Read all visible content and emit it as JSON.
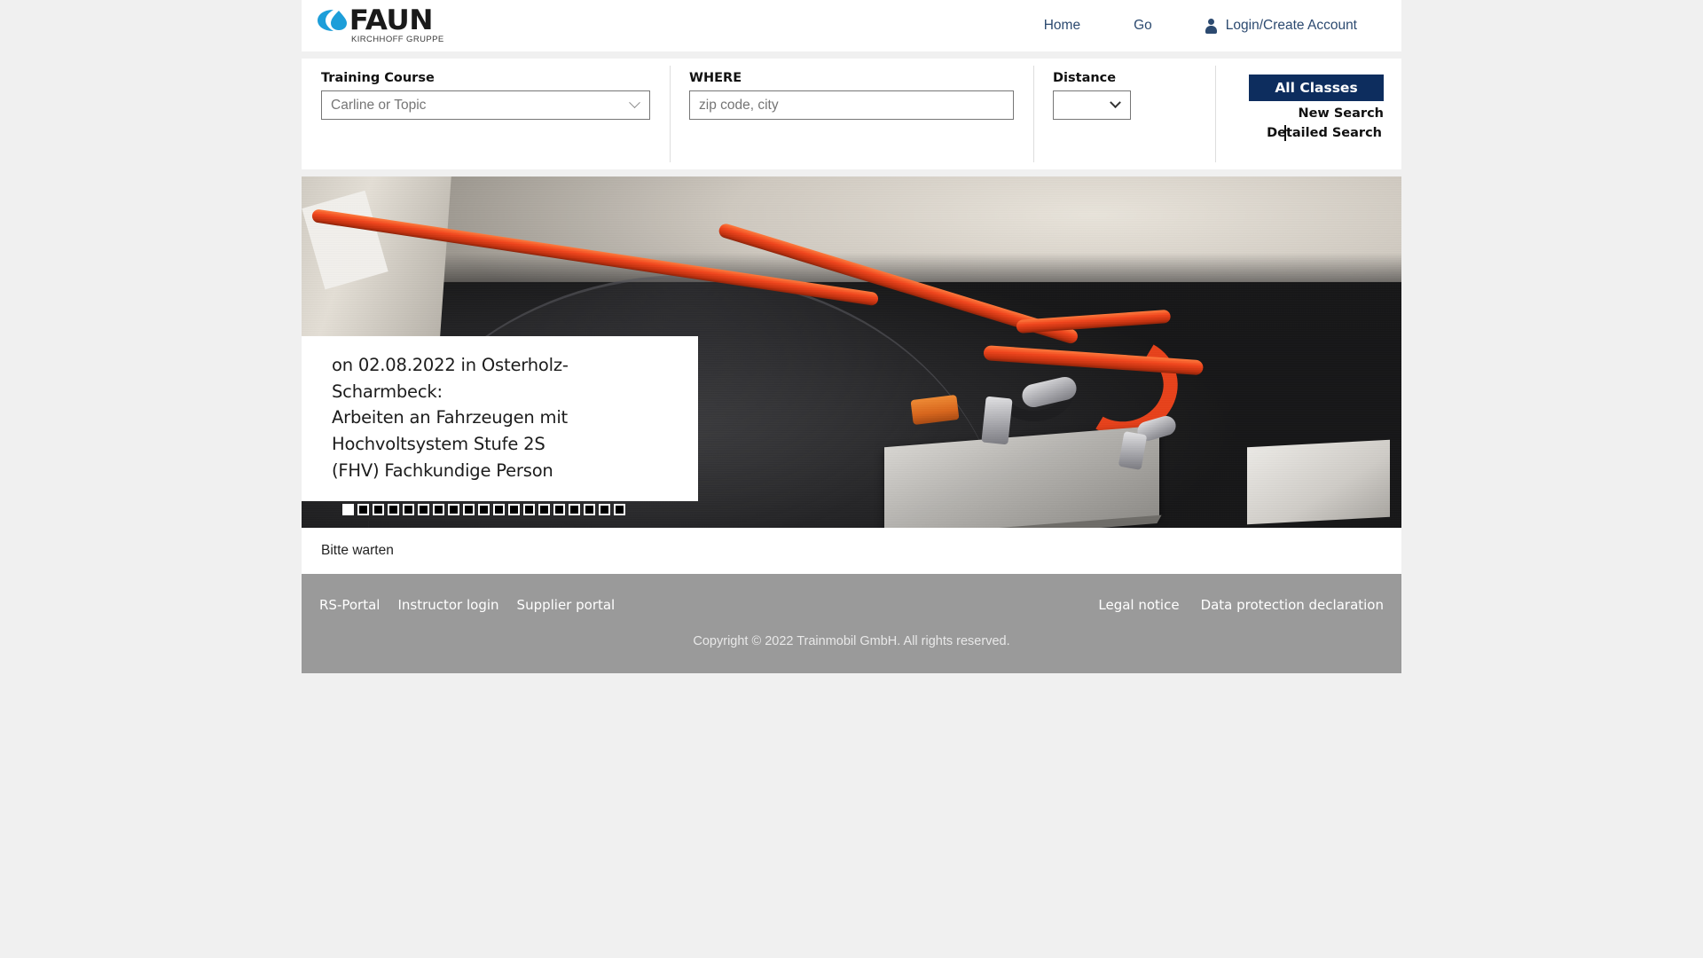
{
  "brand": {
    "logo_word": "FAUN",
    "logo_subtitle": "KIRCHHOFF GRUPPE",
    "logo_mark": "faun-drop-logo"
  },
  "nav": {
    "items": [
      {
        "label": "Home"
      },
      {
        "label": "Go"
      }
    ],
    "account": {
      "label": "Login/Create Account",
      "icon": "person-icon"
    }
  },
  "search": {
    "course": {
      "label": "Training Course",
      "placeholder": "Carline or Topic",
      "value": "Carline or Topic"
    },
    "where": {
      "label": "WHERE",
      "placeholder": "zip code, city",
      "value": ""
    },
    "distance": {
      "label": "Distance",
      "value": ""
    },
    "actions": {
      "all_classes": "All Classes",
      "new_search": "New Search",
      "detailed_search": "Detailed Search"
    }
  },
  "hero": {
    "image_alt": "high-voltage-vehicle-components",
    "caption": {
      "line1": "on 02.08.2022 in Osterholz-Scharmbeck:",
      "line2": "Arbeiten an Fahrzeugen mit Hochvoltsystem Stufe 2S",
      "line3": "(FHV) Fachkundige Person"
    },
    "slides_total": 19,
    "active_slide": 1
  },
  "status": {
    "message": "Bitte warten"
  },
  "footer": {
    "left_links": [
      {
        "label": "RS-Portal"
      },
      {
        "label": "Instructor login"
      },
      {
        "label": "Supplier portal"
      }
    ],
    "right_links": [
      {
        "label": "Legal notice"
      },
      {
        "label": "Data protection declaration"
      }
    ],
    "copyright": "Copyright © 2022 Trainmobil GmbH. All rights reserved."
  },
  "colors": {
    "primary_button": "#0d2d5e",
    "nav_link": "#2c4a70",
    "footer_bg": "#9a9a9a",
    "page_bg": "#f0f0f0",
    "logo_blue": "#1d9ed9"
  }
}
